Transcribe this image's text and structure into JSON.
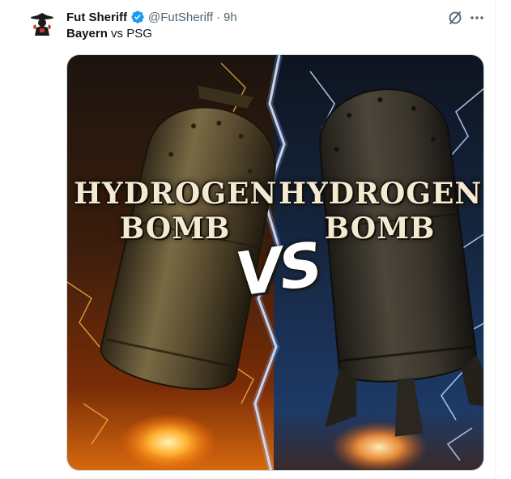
{
  "tweet": {
    "display_name": "Fut Sheriff",
    "handle": "@FutSheriff",
    "separator": "·",
    "time": "9h",
    "text_bold": "Bayern",
    "text_rest": " vs PSG"
  },
  "media": {
    "left_label_line1": "HYDROGEN",
    "left_label_line2": "BOMB",
    "right_label_line1": "HYDROGEN",
    "right_label_line2": "BOMB",
    "vs_text": "VS"
  },
  "colors": {
    "verified_blue": "#1d9bf0",
    "text_primary": "#0f1419",
    "text_secondary": "#536471"
  },
  "icons": {
    "verified": "verified-badge-icon",
    "grok": "grok-icon",
    "more": "more-options-icon"
  }
}
